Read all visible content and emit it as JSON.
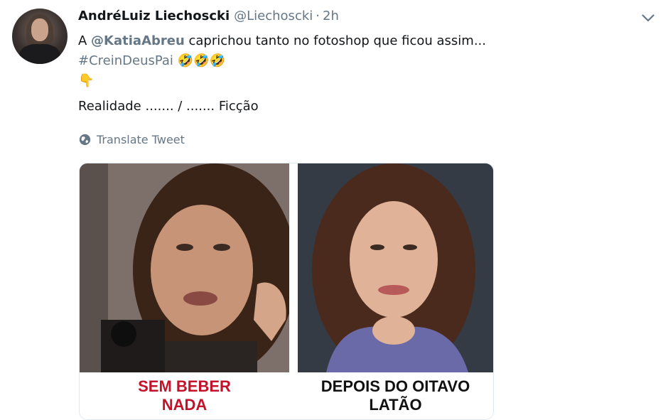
{
  "tweet": {
    "display_name": "AndréLuiz Liechoscki",
    "handle": "@Liechoscki",
    "separator": "·",
    "time": "2h",
    "text": {
      "line1_prefix": "A ",
      "mention": "@KatiaAbreu",
      "line1_suffix": " caprichou tanto no fotoshop que ficou assim...",
      "hashtag": "#CreinDeusPai",
      "hashtag_emojis": "🤣🤣🤣",
      "pointing_emoji": "👇",
      "line4": "Realidade ....... / ....... Ficção"
    },
    "translate_label": "Translate Tweet"
  },
  "media": {
    "left_caption_line1": "SEM BEBER",
    "left_caption_line2": "NADA",
    "right_caption_line1": "DEPOIS DO OITAVO",
    "right_caption_line2": "LATÃO"
  },
  "colors": {
    "text_primary": "#14171a",
    "text_secondary": "#657786",
    "caption_red": "#c4122a",
    "caption_black": "#111111"
  },
  "icons": [
    "chevron-down-icon",
    "globe-icon"
  ]
}
